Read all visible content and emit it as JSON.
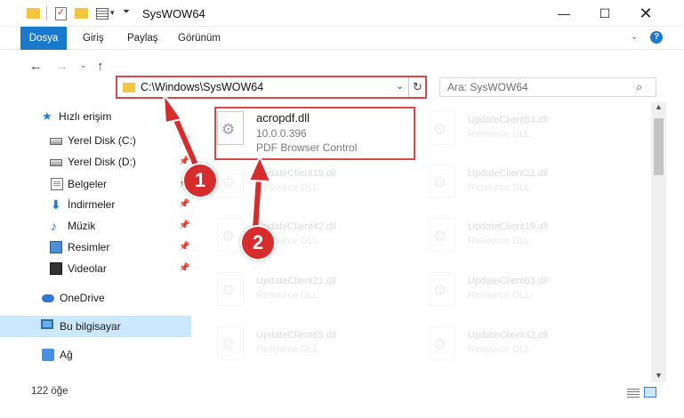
{
  "window": {
    "title": "SysWOW64",
    "min_label": "—",
    "max_label": "☐",
    "close_label": "✕"
  },
  "ribbon": {
    "tabs": [
      "Dosya",
      "Giriş",
      "Paylaş",
      "Görünüm"
    ],
    "expand_label": "⌄",
    "help_label": "?"
  },
  "nav": {
    "back": "←",
    "forward": "→",
    "recent": "⌄",
    "up": "↑",
    "address": "C:\\Windows\\SysWOW64",
    "address_dd": "⌄",
    "refresh": "↻"
  },
  "search": {
    "placeholder": "Ara: SysWOW64",
    "icon": "⌕"
  },
  "sidebar": {
    "items": [
      {
        "label": "Hızlı erişim",
        "icon": "star-icon"
      },
      {
        "label": "Yerel Disk (C:)",
        "icon": "disk-icon",
        "pin": "📌"
      },
      {
        "label": "Yerel Disk (D:)",
        "icon": "disk-icon",
        "pin": "📌"
      },
      {
        "label": "Belgeler",
        "icon": "document-icon",
        "pin": "📌"
      },
      {
        "label": "İndirmeler",
        "icon": "download-icon",
        "pin": "📌"
      },
      {
        "label": "Müzik",
        "icon": "music-icon",
        "pin": "📌"
      },
      {
        "label": "Resimler",
        "icon": "pictures-icon",
        "pin": "📌"
      },
      {
        "label": "Videolar",
        "icon": "videos-icon",
        "pin": "📌"
      },
      {
        "label": "OneDrive",
        "icon": "cloud-icon"
      },
      {
        "label": "Bu bilgisayar",
        "icon": "computer-icon",
        "selected": true
      },
      {
        "label": "Ağ",
        "icon": "network-icon"
      }
    ]
  },
  "files": {
    "highlighted": {
      "name": "acropdf.dll",
      "version": "10.0.0.396",
      "description": "PDF Browser Control"
    },
    "faded": [
      {
        "name": "UpdateClient63.dll",
        "type": "Resource DLL"
      },
      {
        "name": "UpdateClient19.dll",
        "type": "Resource DLL"
      },
      {
        "name": "UpdateClient21.dll",
        "type": "Resource DLL"
      },
      {
        "name": "UpdateClient42.dll",
        "type": "Resource DLL"
      },
      {
        "name": "UpdateClient19.dll",
        "type": "Resource DLL"
      },
      {
        "name": "UpdateClient21.dll",
        "type": "Resource DLL"
      },
      {
        "name": "UpdateClient63.dll",
        "type": "Resource DLL"
      },
      {
        "name": "UpdateClient65.dll",
        "type": "Resource DLL"
      },
      {
        "name": "UpdateClient42.dll",
        "type": "Resource DLL"
      }
    ]
  },
  "status": {
    "count": "122 öğe"
  },
  "annotations": {
    "marker1": "1",
    "marker2": "2",
    "color": "#d62c2c"
  },
  "colors": {
    "accent": "#1979ca",
    "highlight_border": "#d9474d",
    "selected_bg": "#cce8ff"
  }
}
